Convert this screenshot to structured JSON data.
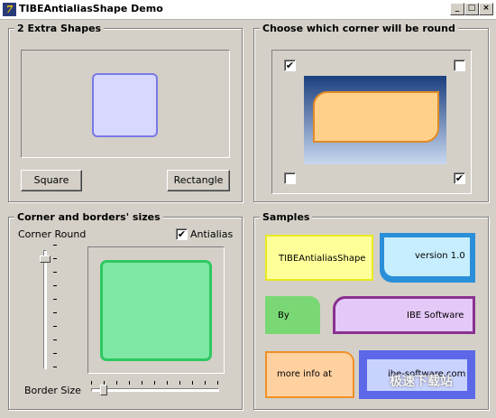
{
  "window": {
    "title": "TIBEAntialiasShape Demo",
    "icon": "7"
  },
  "titlebar_buttons": {
    "minimize": "_",
    "maximize": "□",
    "close": "×"
  },
  "extra_shapes": {
    "title": "2 Extra Shapes",
    "square_button": "Square",
    "rectangle_button": "Rectangle"
  },
  "corners": {
    "title": "Choose which corner will be round",
    "top_left_checked": true,
    "top_right_checked": false,
    "bottom_left_checked": false,
    "bottom_right_checked": true,
    "check_mark": "✔"
  },
  "sizes": {
    "title": "Corner and borders' sizes",
    "corner_round_label": "Corner Round",
    "antialias_label": "Antialias",
    "antialias_checked": true,
    "border_size_label": "Border Size"
  },
  "samples": {
    "title": "Samples",
    "items": [
      "TIBEAntialiasShape",
      "version 1.0",
      "By",
      "IBE Software",
      "more info at",
      "ibe-software.com"
    ]
  },
  "watermark": "极速下载站",
  "colors": {
    "shape_lavender": "#d8d8ff",
    "shape_lavender_border": "#7878e8",
    "corner_shape_fill": "#ffd08a",
    "corner_shape_border": "#e08a28",
    "gradient_top": "#1c3f7e",
    "gradient_bottom": "#c8d8f0",
    "green_fill": "#7ee8a4",
    "green_border": "#2ec862"
  }
}
